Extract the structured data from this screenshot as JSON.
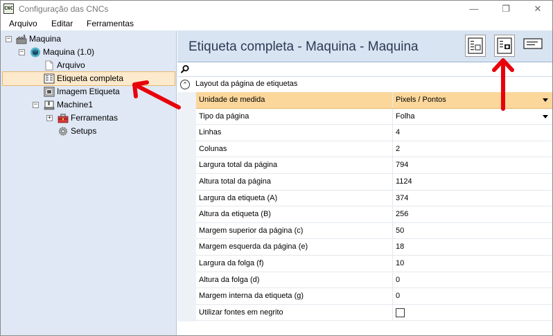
{
  "window": {
    "title": "Configuração das CNCs",
    "app_icon_text": "CNC"
  },
  "menu": [
    "Arquivo",
    "Editar",
    "Ferramentas"
  ],
  "tree": {
    "root": "Maquina",
    "machine": "Maquina (1.0)",
    "arquivo": "Arquivo",
    "etiqueta_completa": "Etiqueta completa",
    "imagem_etiqueta": "Imagem Etiqueta",
    "machine1": "Machine1",
    "ferramentas": "Ferramentas",
    "setups": "Setups"
  },
  "content": {
    "title": "Etiqueta completa - Maquina - Maquina",
    "category": "Layout da página de etiquetas",
    "properties": [
      {
        "name": "Unidade de medida",
        "value": "Pixels / Pontos"
      },
      {
        "name": "Tipo da página",
        "value": "Folha"
      },
      {
        "name": "Linhas",
        "value": "4"
      },
      {
        "name": "Colunas",
        "value": "2"
      },
      {
        "name": "Largura total da página",
        "value": "794"
      },
      {
        "name": "Altura total da página",
        "value": "1124"
      },
      {
        "name": "Largura da etiqueta (A)",
        "value": "374"
      },
      {
        "name": "Altura da etiqueta (B)",
        "value": "256"
      },
      {
        "name": "Margem superior da página (c)",
        "value": "50"
      },
      {
        "name": "Margem esquerda da página (e)",
        "value": "18"
      },
      {
        "name": "Largura da folga (f)",
        "value": "10"
      },
      {
        "name": "Altura da folga (d)",
        "value": "0"
      },
      {
        "name": "Margem interna da etiqueta (g)",
        "value": "0"
      },
      {
        "name": "Utilizar fontes em negrito",
        "value": ""
      }
    ]
  },
  "colors": {
    "selection": "#fbd79b",
    "tree_bg": "#dfe8f4",
    "header_bg": "#d8e4f2",
    "annotation_arrow": "#e8000b"
  }
}
